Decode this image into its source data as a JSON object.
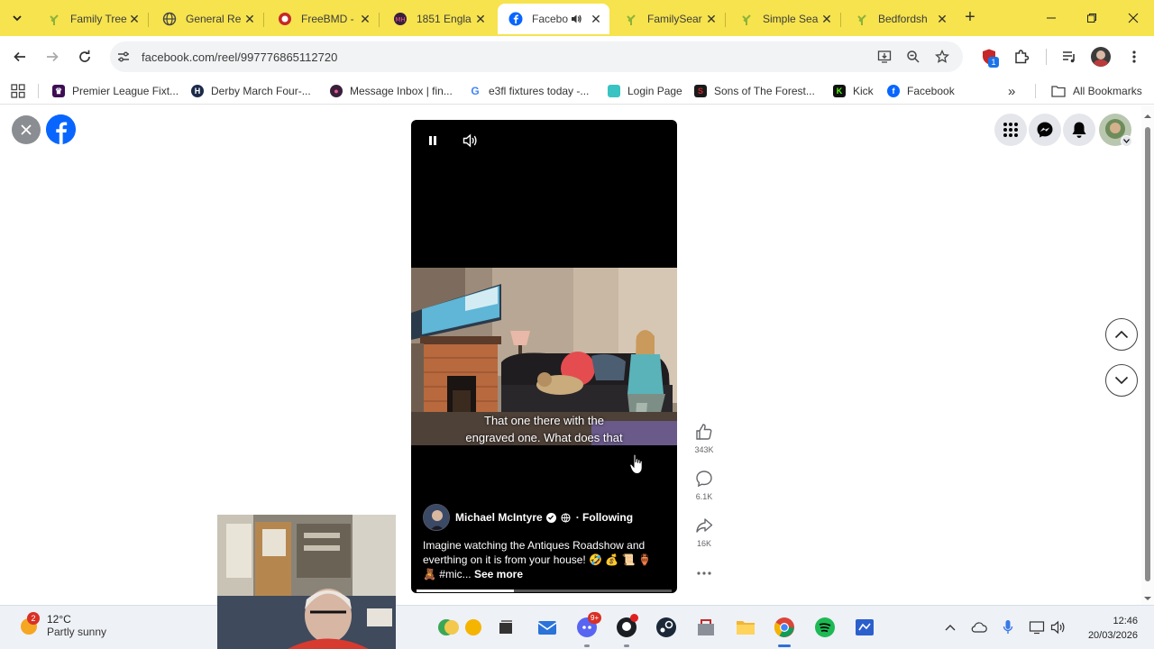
{
  "tabs": [
    {
      "title": "Family Tree",
      "icon": "familysearch-tree-icon",
      "active": false
    },
    {
      "title": "General Re",
      "icon": "globe-icon",
      "active": false
    },
    {
      "title": "FreeBMD -",
      "icon": "freebmd-icon",
      "active": false
    },
    {
      "title": "1851 Engla",
      "icon": "myheritage-icon",
      "active": false
    },
    {
      "title": "Facebo",
      "icon": "facebook-icon",
      "active": true,
      "audio": true
    },
    {
      "title": "FamilySear",
      "icon": "familysearch-tree-icon",
      "active": false
    },
    {
      "title": "Simple Sea",
      "icon": "familysearch-tree-icon",
      "active": false
    },
    {
      "title": "Bedfordsh",
      "icon": "familysearch-tree-icon",
      "active": false
    }
  ],
  "toolbar": {
    "url": "facebook.com/reel/997776865112720",
    "extension_badge": "1"
  },
  "bookmarks": {
    "items": [
      {
        "label": "Premier League Fixt...",
        "icon": "premier-league-icon"
      },
      {
        "label": "Derby March Four-...",
        "icon": "h-icon"
      },
      {
        "label": "Message Inbox | fin...",
        "icon": "findmypast-icon"
      },
      {
        "label": "e3fl fixtures today -...",
        "icon": "google-icon"
      },
      {
        "label": "Login Page",
        "icon": "login-page-icon"
      },
      {
        "label": "Sons of The Forest...",
        "icon": "sons-forest-icon"
      },
      {
        "label": "Kick",
        "icon": "kick-icon"
      },
      {
        "label": "Facebook",
        "icon": "facebook-icon"
      }
    ],
    "all_bookmarks": "All Bookmarks"
  },
  "reel": {
    "caption_line1": "That one there with the",
    "caption_line2": "engraved one. What does that",
    "author": "Michael McIntyre",
    "follow_status": "· Following",
    "description": "Imagine watching the Antiques Roadshow and everthing on it is from your house! 🤣 💰 📜 🏺 🧸 #mic...",
    "see_more": "See more",
    "progress": 0.38
  },
  "actions": {
    "likes": "343K",
    "comments": "6.1K",
    "shares": "16K"
  },
  "taskbar": {
    "weather_badge": "2",
    "temperature": "12°C",
    "condition": "Partly sunny",
    "time": "12:46",
    "date": "20/03/2026",
    "discord_badge": "9+"
  },
  "colors": {
    "tabstrip": "#f6e34e",
    "facebook_blue": "#0866ff",
    "reel_bg": "#000000"
  }
}
